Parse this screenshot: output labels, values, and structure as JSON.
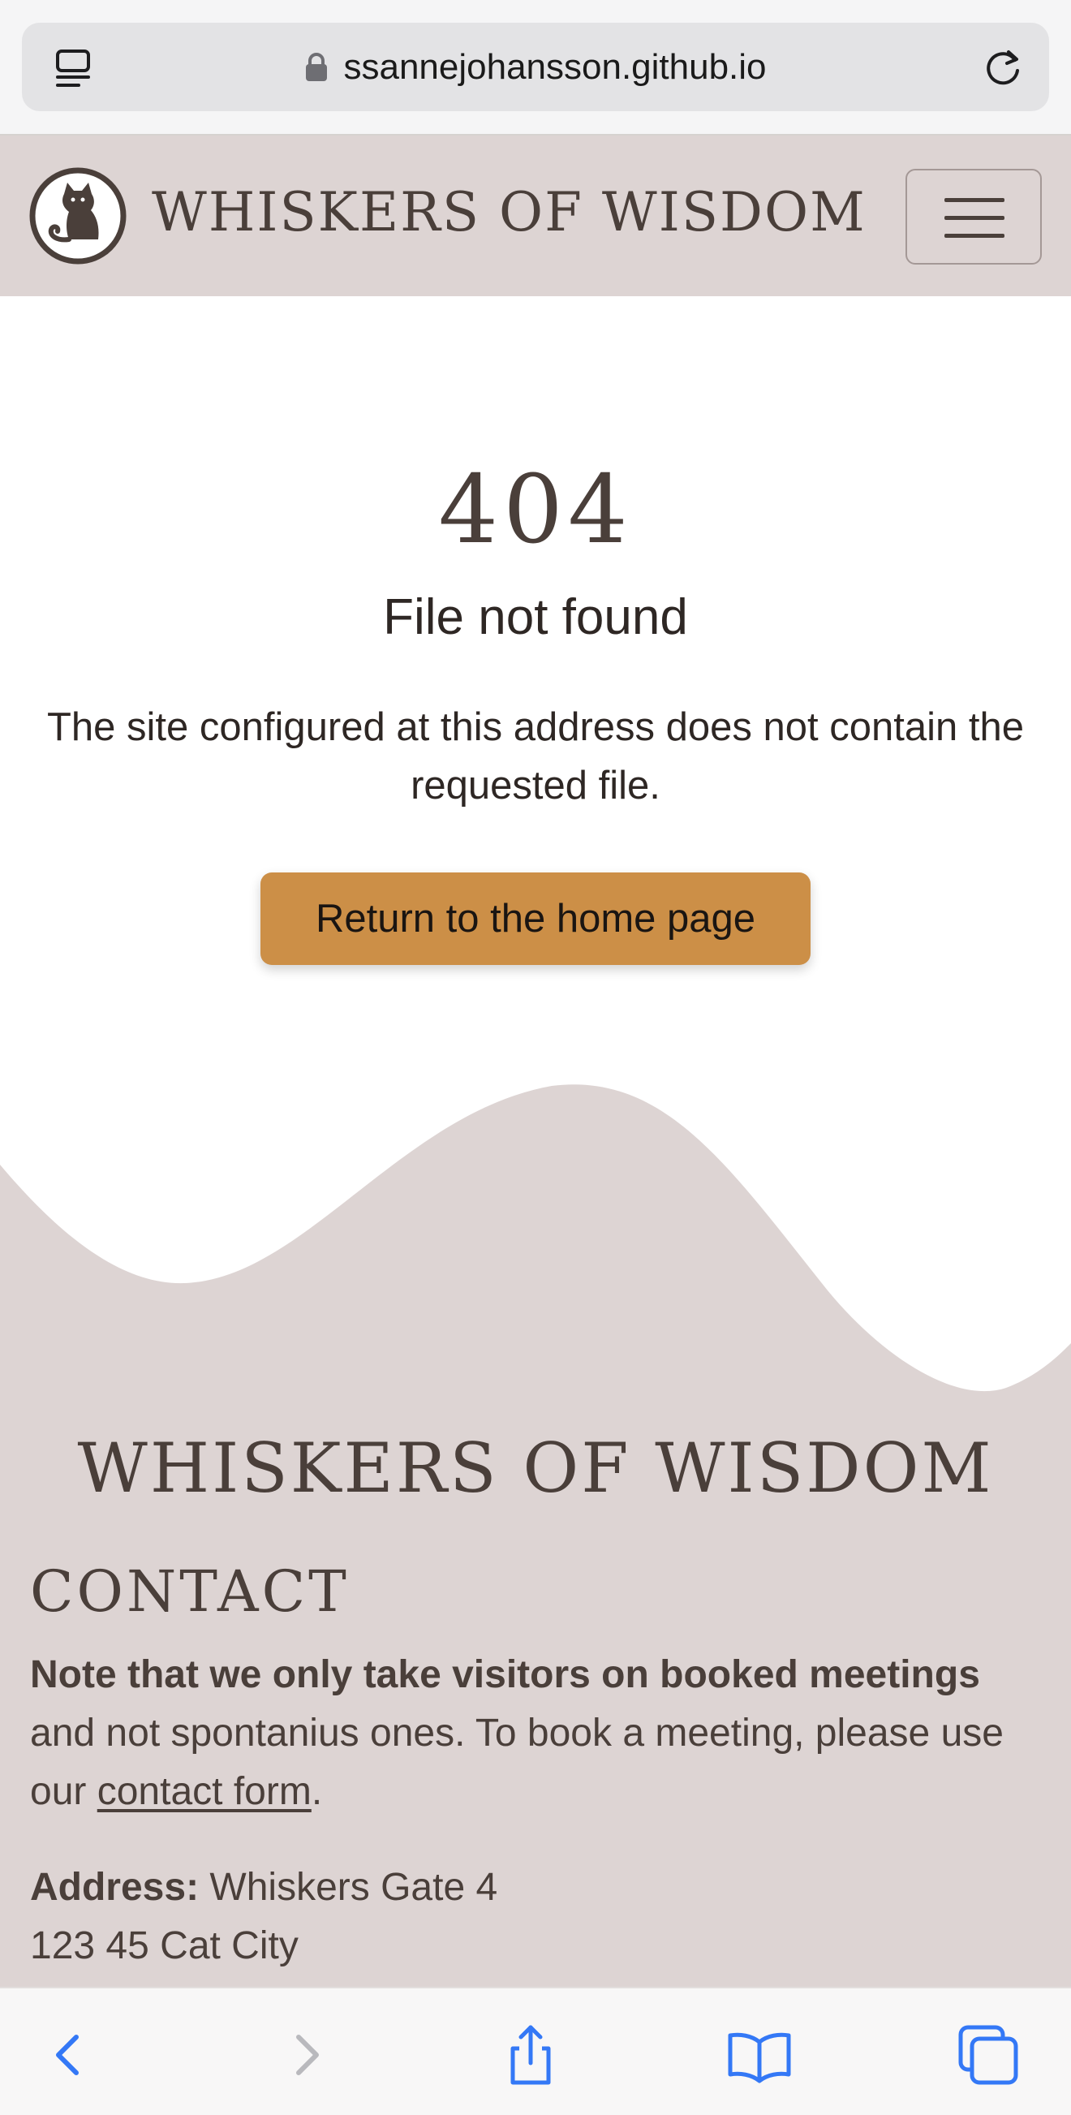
{
  "browser": {
    "url": "ssannejohansson.github.io",
    "icons": [
      "tabs-icon",
      "lock-icon",
      "reload-icon",
      "back-icon",
      "forward-icon",
      "share-icon",
      "bookmarks-icon",
      "tabs-overview-icon"
    ],
    "accent_color": "#3478f6"
  },
  "nav": {
    "brand": "Whiskers of Wisdom",
    "logo_icon": "cat-logo-icon",
    "menu_icon": "hamburger-icon"
  },
  "main": {
    "code": "404",
    "title": "File not found",
    "message": "The site configured at this address does not contain the requested file.",
    "button_label": "Return to the home page"
  },
  "footer": {
    "brand": "Whiskers of Wisdom",
    "contact_heading": "Contact",
    "note_bold": "Note that we only take visitors on booked meetings",
    "note_rest": " and not spontanius ones. To book a meeting, please use our ",
    "note_link": "contact form",
    "note_end": ".",
    "address_label": "Address:",
    "address_line1": " Whiskers Gate 4",
    "address_line2": "123 45 Cat City"
  },
  "colors": {
    "nav_bg": "#ddd4d3",
    "text": "#4a3f3a",
    "button": "#cc8f47",
    "page_bg": "#ffffff"
  }
}
